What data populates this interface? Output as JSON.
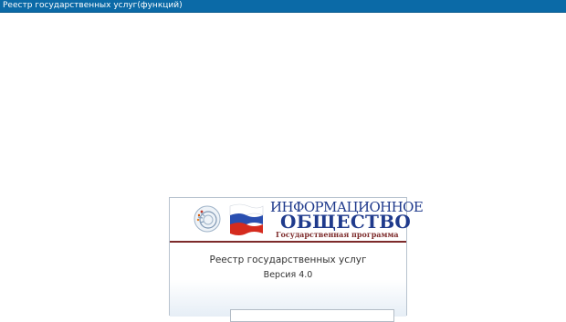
{
  "window": {
    "title": "Реестр государственных услуг(функций)"
  },
  "banner": {
    "line1": "ИНФОРМАЦИОННОЕ",
    "line2": "ОБЩЕСТВО",
    "line3": "Государственная программа",
    "emblem_icon": "info-society-emblem-icon",
    "flag_icon": "russian-flag-icon",
    "colors": {
      "banner_text": "#1f3a8c",
      "accent_red": "#7d2b2b",
      "titlebar": "#0b6aa7"
    }
  },
  "app": {
    "title": "Реестр государственных услуг",
    "version": "Версия 4.0"
  },
  "login": {
    "field_value": ""
  }
}
